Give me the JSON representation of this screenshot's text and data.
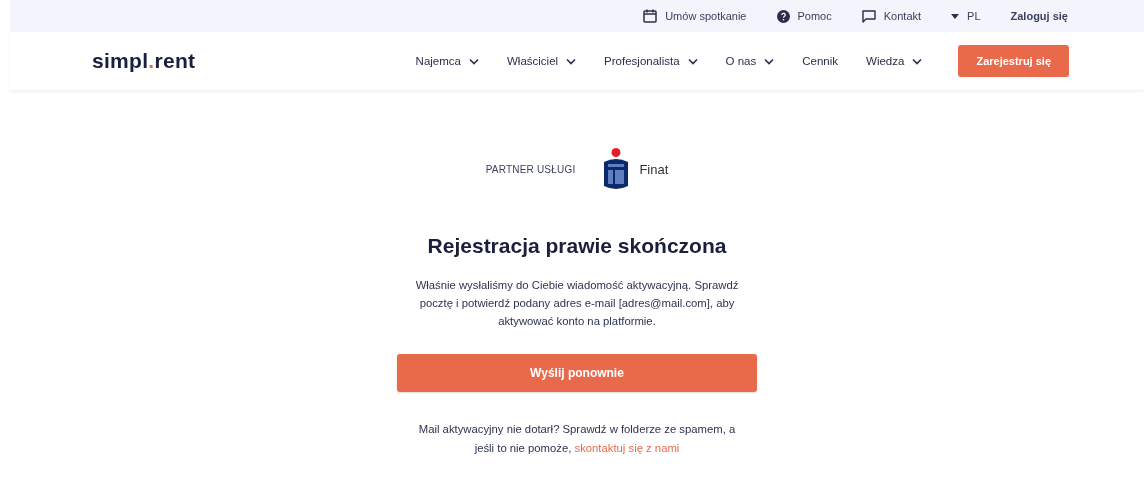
{
  "top_bar": {
    "items": [
      {
        "kind": "calendar",
        "label": "Umów spotkanie"
      },
      {
        "kind": "help",
        "label": "Pomoc"
      },
      {
        "kind": "chat",
        "label": "Kontakt"
      },
      {
        "kind": "language",
        "label": "PL"
      },
      {
        "kind": "login",
        "label": "Zaloguj się"
      }
    ]
  },
  "nav": {
    "logo": {
      "before": "simpl",
      "dot": ".",
      "after": "rent"
    },
    "items": [
      {
        "label": "Najemca",
        "dropdown": true
      },
      {
        "label": "Właściciel",
        "dropdown": true
      },
      {
        "label": "Profesjonalista",
        "dropdown": true
      },
      {
        "label": "O nas",
        "dropdown": true
      },
      {
        "label": "Cennik",
        "dropdown": false
      },
      {
        "label": "Wiedza",
        "dropdown": true
      }
    ],
    "cta": "Zarejestruj się"
  },
  "partner": {
    "label": "PARTNER USŁUGI",
    "name": "Finat"
  },
  "title": "Rejestracja prawie skończona",
  "message": "Właśnie wysłaliśmy do Ciebie wiadomość aktywacyjną. Sprawdź pocztę i potwierdź podany adres e-mail [adres@mail.com], aby aktywować konto na platformie.",
  "resend_button": "Wyślij ponownie",
  "help": {
    "text": "Mail aktywacyjny nie dotarł? Sprawdź w folderze ze spamem, a jeśli to nie pomoże,",
    "link": "skontaktuj się z nami"
  }
}
